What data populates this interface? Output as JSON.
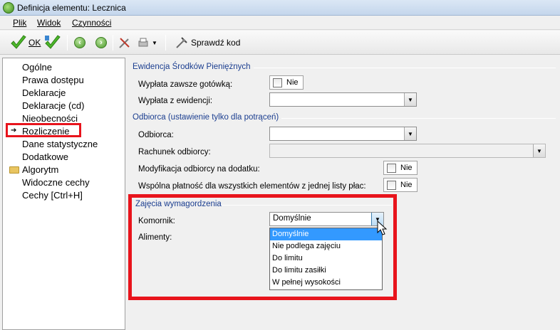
{
  "window": {
    "title": "Definicja elementu: Lecznica"
  },
  "menu": {
    "items": [
      "Plik",
      "Widok",
      "Czynności"
    ]
  },
  "toolbar": {
    "ok_label": "OK",
    "check_code_label": "Sprawdź kod"
  },
  "tree": {
    "items": [
      "Ogólne",
      "Prawa dostępu",
      "Deklaracje",
      "Deklaracje (cd)",
      "Nieobecności",
      "Rozliczenie",
      "Dane statystyczne",
      "Dodatkowe",
      "Algorytm",
      "Widoczne cechy",
      "Cechy [Ctrl+H]"
    ],
    "selected": "Rozliczenie"
  },
  "sections": {
    "cash": {
      "title": "Ewidencja Środków Pieniężnych",
      "always_cash_label": "Wypłata zawsze gotówką:",
      "always_cash_value": "Nie",
      "from_register_label": "Wypłata z ewidencji:",
      "from_register_value": ""
    },
    "recipient": {
      "title": "Odbiorca (ustawienie tylko dla potrąceń)",
      "recipient_label": "Odbiorca:",
      "recipient_value": "",
      "account_label": "Rachunek odbiorcy:",
      "account_value": "",
      "modify_label": "Modyfikacja odbiorcy na dodatku:",
      "modify_value": "Nie",
      "common_payment_label": "Wspólna płatność dla wszystkich elementów z jednej listy płac:",
      "common_payment_value": "Nie"
    },
    "seizure": {
      "title": "Zajęcia wymagordzenia",
      "bailiff_label": "Komornik:",
      "bailiff_value": "Domyślnie",
      "alimony_label": "Alimenty:",
      "options": [
        "Domyślnie",
        "Nie podlega zajęciu",
        "Do limitu",
        "Do limitu zasiłki",
        "W pełnej wysokości"
      ],
      "highlighted_option": "Domyślnie"
    }
  },
  "colors": {
    "highlight": "#e8141c",
    "selection": "#3399ff",
    "group_title": "#1a3d8f"
  }
}
